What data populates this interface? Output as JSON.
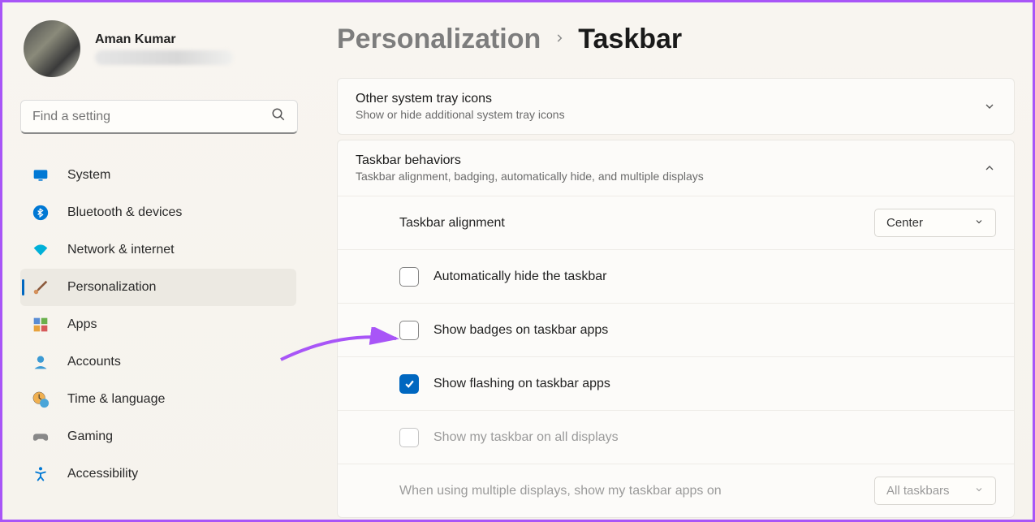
{
  "profile": {
    "name": "Aman Kumar"
  },
  "search": {
    "placeholder": "Find a setting"
  },
  "sidebar": {
    "items": [
      {
        "label": "System"
      },
      {
        "label": "Bluetooth & devices"
      },
      {
        "label": "Network & internet"
      },
      {
        "label": "Personalization"
      },
      {
        "label": "Apps"
      },
      {
        "label": "Accounts"
      },
      {
        "label": "Time & language"
      },
      {
        "label": "Gaming"
      },
      {
        "label": "Accessibility"
      }
    ]
  },
  "breadcrumb": {
    "parent": "Personalization",
    "current": "Taskbar"
  },
  "cards": {
    "other_tray": {
      "title": "Other system tray icons",
      "subtitle": "Show or hide additional system tray icons"
    },
    "behaviors": {
      "title": "Taskbar behaviors",
      "subtitle": "Taskbar alignment, badging, automatically hide, and multiple displays"
    }
  },
  "settings": {
    "alignment": {
      "label": "Taskbar alignment",
      "value": "Center"
    },
    "auto_hide": {
      "label": "Automatically hide the taskbar",
      "checked": false
    },
    "badges": {
      "label": "Show badges on taskbar apps",
      "checked": false
    },
    "flashing": {
      "label": "Show flashing on taskbar apps",
      "checked": true
    },
    "all_displays": {
      "label": "Show my taskbar on all displays",
      "checked": false,
      "disabled": true
    },
    "multi_display": {
      "label": "When using multiple displays, show my taskbar apps on",
      "value": "All taskbars",
      "disabled": true
    }
  }
}
